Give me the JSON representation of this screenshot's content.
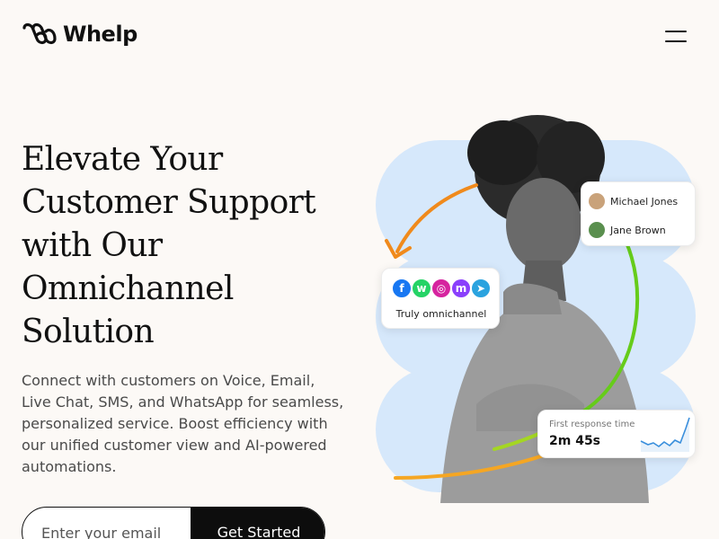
{
  "brand": {
    "name": "Whelp",
    "logo_icon": "double-loop-logo-icon"
  },
  "header": {
    "menu_icon": "hamburger-menu-icon"
  },
  "hero": {
    "title_lines": [
      "Elevate Your",
      "Customer Support",
      "with Our",
      "Omnichannel",
      "Solution"
    ],
    "description_lines": [
      "Connect with customers on Voice, Email,",
      "Live Chat, SMS, and WhatsApp for seamless,",
      "personalized service. Boost efficiency with",
      "our unified customer view and AI-powered",
      "automations."
    ]
  },
  "signup": {
    "email_placeholder": "Enter your email",
    "cta_label": "Get Started"
  },
  "illustration": {
    "contacts": [
      {
        "name": "Michael Jones",
        "avatar_color": "#c9a27a"
      },
      {
        "name": "Jane Brown",
        "avatar_color": "#5a8f4e"
      }
    ],
    "channels": {
      "label": "Truly omnichannel",
      "icons": [
        {
          "name": "facebook-icon",
          "color": "#1877f2",
          "glyph": "f"
        },
        {
          "name": "whatsapp-icon",
          "color": "#25d366",
          "glyph": "w"
        },
        {
          "name": "instagram-icon",
          "color": "#d6249f",
          "glyph": "◎"
        },
        {
          "name": "messenger-icon",
          "color": "#8a3ffc",
          "glyph": "m"
        },
        {
          "name": "telegram-icon",
          "color": "#2aa3df",
          "glyph": "➤"
        }
      ]
    },
    "metric": {
      "label": "First response time",
      "value": "2m 45s"
    },
    "colors": {
      "blob": "#d6e8fb",
      "arc_orange": "#f08a1c",
      "arc_green": "#66cc1a",
      "spark": "#3a8fdc"
    }
  }
}
